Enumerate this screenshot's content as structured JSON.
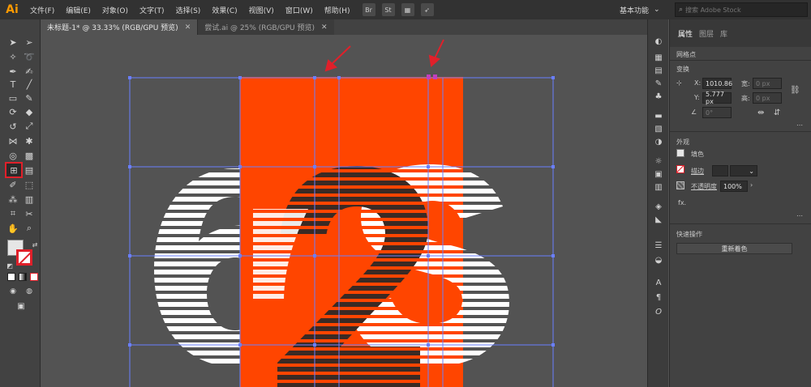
{
  "app": {
    "logo": "Ai"
  },
  "menu": [
    "文件(F)",
    "编辑(E)",
    "对象(O)",
    "文字(T)",
    "选择(S)",
    "效果(C)",
    "视图(V)",
    "窗口(W)",
    "帮助(H)"
  ],
  "toolbar_icons": [
    "Br",
    "St"
  ],
  "workspace": {
    "label": "基本功能",
    "arrow": "⌄"
  },
  "search": {
    "placeholder": "搜索 Adobe Stock"
  },
  "tabs": [
    {
      "label": "未标题-1* @ 33.33% (RGB/GPU 预览)",
      "active": true
    },
    {
      "label": "尝试.ai @ 25% (RGB/GPU 预览)",
      "active": false
    }
  ],
  "panel": {
    "tabs": [
      "属性",
      "图层",
      "库"
    ],
    "anchor_label": "网格点",
    "transform_title": "变换",
    "x_label": "X:",
    "x_value": "1010.86",
    "y_label": "Y:",
    "y_value": "5.777 px",
    "w_label": "宽:",
    "w_value": "0 px",
    "h_label": "高:",
    "h_value": "0 px",
    "angle_value": "0°",
    "appearance_title": "外观",
    "fill_label": "填色",
    "stroke_label": "描边",
    "opacity_label": "不透明度",
    "opacity_value": "100%",
    "fx_label": "fx.",
    "quick_actions_title": "快速操作",
    "recolor_button": "重新着色"
  },
  "colors": {
    "accent_orange": "#ff4500",
    "guide_blue": "#6a7fff",
    "selection_magenta": "#c040c0",
    "arrow_red": "#e0202a",
    "stripes_white": "#ffffff",
    "stripes_dark": "#3b2a24"
  }
}
